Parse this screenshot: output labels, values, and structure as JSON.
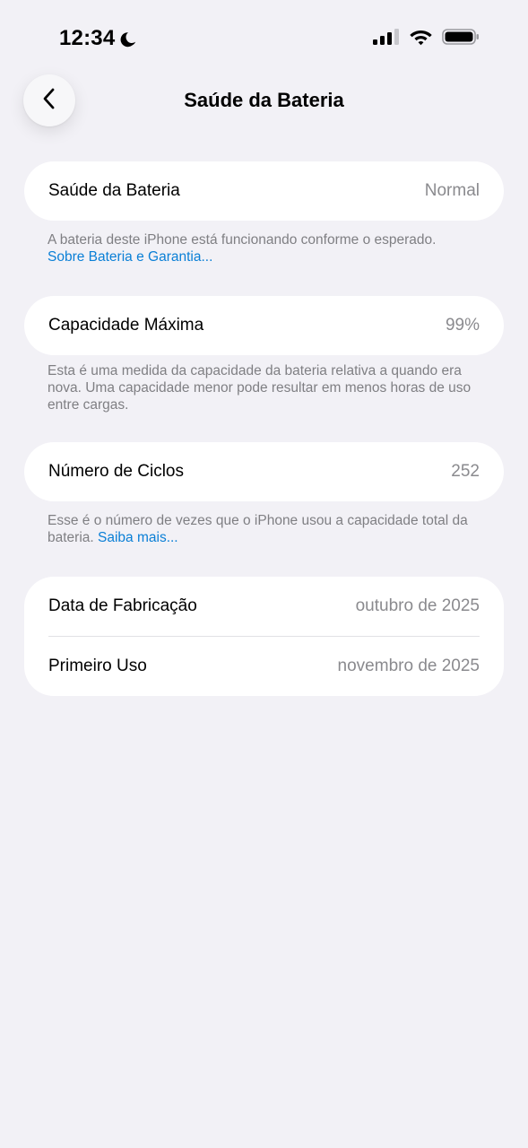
{
  "status_bar": {
    "time": "12:34",
    "icons": [
      "moon-icon",
      "cellular-signal-icon",
      "wifi-icon",
      "battery-icon"
    ]
  },
  "nav": {
    "title": "Saúde da Bateria",
    "back_icon": "chevron-left-icon"
  },
  "sections": {
    "health": {
      "label": "Saúde da Bateria",
      "value": "Normal",
      "footnote": "A bateria deste iPhone está funcionando conforme o esperado.",
      "link": "Sobre Bateria e Garantia..."
    },
    "capacity": {
      "label": "Capacidade Máxima",
      "value": "99%",
      "footnote": "Esta é uma medida da capacidade da bateria relativa a quando era nova. Uma capacidade menor pode resultar em menos horas de uso entre cargas."
    },
    "cycles": {
      "label": "Número de Ciclos",
      "value": "252",
      "footnote": "Esse é o número de vezes que o iPhone usou a capacidade total da bateria.",
      "link": "Saiba mais..."
    },
    "dates": {
      "manufacture_label": "Data de Fabricação",
      "manufacture_value": "outubro de 2025",
      "first_use_label": "Primeiro Uso",
      "first_use_value": "novembro de 2025"
    }
  },
  "colors": {
    "background": "#f2f1f6",
    "card": "#ffffff",
    "secondary_text": "#8a8a8e",
    "link": "#0a7fd6"
  }
}
